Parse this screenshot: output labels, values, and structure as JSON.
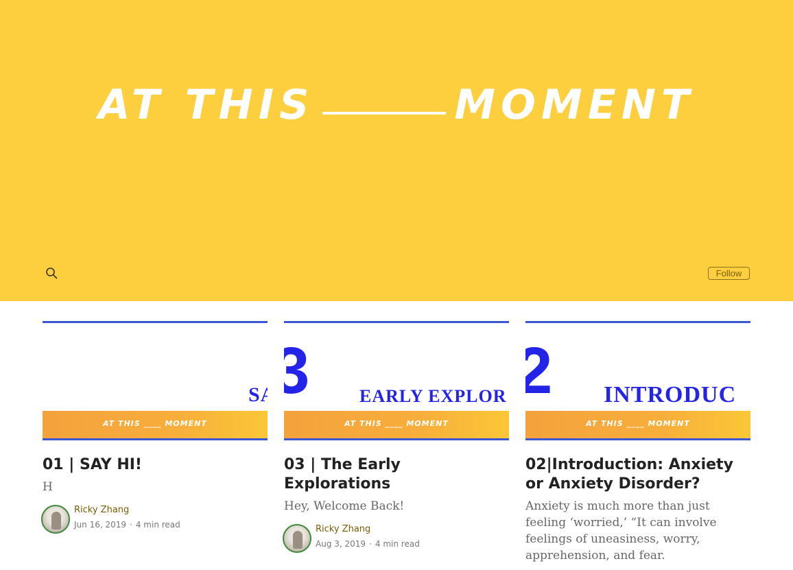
{
  "hero": {
    "title_left": "AT THIS",
    "title_right": "MOMENT",
    "follow_label": "Follow",
    "background": "#fdce3e"
  },
  "cards": [
    {
      "thumb": {
        "number": "",
        "word": "SA",
        "band_text": "AT THIS ____ MOMENT"
      },
      "title": "01 | SAY HI!",
      "subtitle": "H",
      "author": "Ricky Zhang",
      "date": "Jun 16, 2019",
      "read_time": "4 min read"
    },
    {
      "thumb": {
        "number": "3",
        "word": "EARLY EXPLOR",
        "band_text": "AT THIS ____ MOMENT"
      },
      "title": "03 | The Early Explorations",
      "subtitle": "Hey, Welcome Back!",
      "author": "Ricky Zhang",
      "date": "Aug 3, 2019",
      "read_time": "4 min read"
    },
    {
      "thumb": {
        "number": "2",
        "word": "INTRODUC",
        "band_text": "AT THIS ____ MOMENT"
      },
      "title": "02|Introduction: Anxiety or Anxiety Disorder?",
      "subtitle": "Anxiety is much more than just feeling ‘worried,’ “It can involve feelings of uneasiness, worry, apprehension, and fear."
    }
  ],
  "icons": {
    "search": "search-icon",
    "avatar": "avatar"
  }
}
